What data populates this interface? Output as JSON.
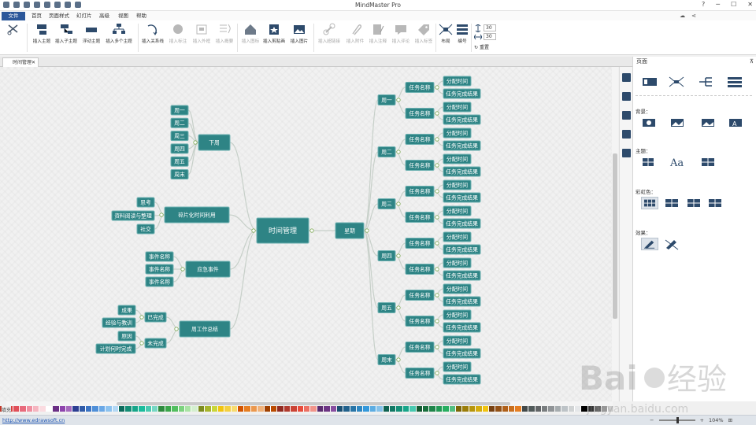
{
  "titlebar": {
    "app_title": "MindMaster Pro"
  },
  "menu": {
    "tabs": [
      "文件",
      "首页",
      "页面样式",
      "幻灯片",
      "高级",
      "视图",
      "帮助"
    ]
  },
  "ribbon": {
    "buttons": [
      "插入主题",
      "插入子主题",
      "浮动主题",
      "插入多个主题",
      "插入关系线",
      "插入标注",
      "插入外框",
      "插入概要",
      "插入图标",
      "插入剪贴画",
      "插入图片",
      "插入超链接",
      "插入附件",
      "插入注释",
      "插入评论",
      "插入标签",
      "布局",
      "编号"
    ],
    "spin_top": "30",
    "spin_bottom": "30",
    "reset_label": "重置"
  },
  "document": {
    "tab_label": "时间管理"
  },
  "mindmap": {
    "root": "时间管理",
    "left_branches": [
      {
        "label": "下周",
        "children": [
          "周一",
          "周二",
          "周三",
          "周四",
          "周五",
          "周末"
        ]
      },
      {
        "label": "碎片化时间利用",
        "children": [
          "思考",
          "资料阅读与整理",
          "社交"
        ]
      },
      {
        "label": "应急事件",
        "children": [
          "事件名称",
          "事件名称",
          "事件名称"
        ]
      },
      {
        "label": "周工作总结",
        "children": [
          {
            "label": "已完成",
            "children": [
              "成果",
              "经验与教训"
            ]
          },
          {
            "label": "未完成",
            "children": [
              "原因",
              "计划何时完成"
            ]
          }
        ]
      }
    ],
    "right_branch": {
      "label": "星期",
      "days": [
        "周一",
        "周二",
        "周三",
        "周四",
        "周五",
        "周末"
      ],
      "task_label": "任务名称",
      "subtask_labels": [
        "分配时间",
        "任务完成结果"
      ]
    }
  },
  "panel": {
    "title": "页面",
    "background_label": "背景：",
    "theme_label": "主题：",
    "rainbow_label": "彩虹色：",
    "effect_label": "效果："
  },
  "bottom": {
    "fill_label": "填充",
    "url": "http://www.edrawsoft.cn",
    "zoom": "104%"
  },
  "colors": {
    "node_fill": "#2e8485",
    "node_stroke": "#6fb2b2",
    "root_fill": "#2e8485",
    "connector": "#c7d0c9",
    "accent": "#2b579a"
  },
  "watermark": {
    "text": "Baidu经验",
    "sub": "jingyan.baidu.com"
  }
}
